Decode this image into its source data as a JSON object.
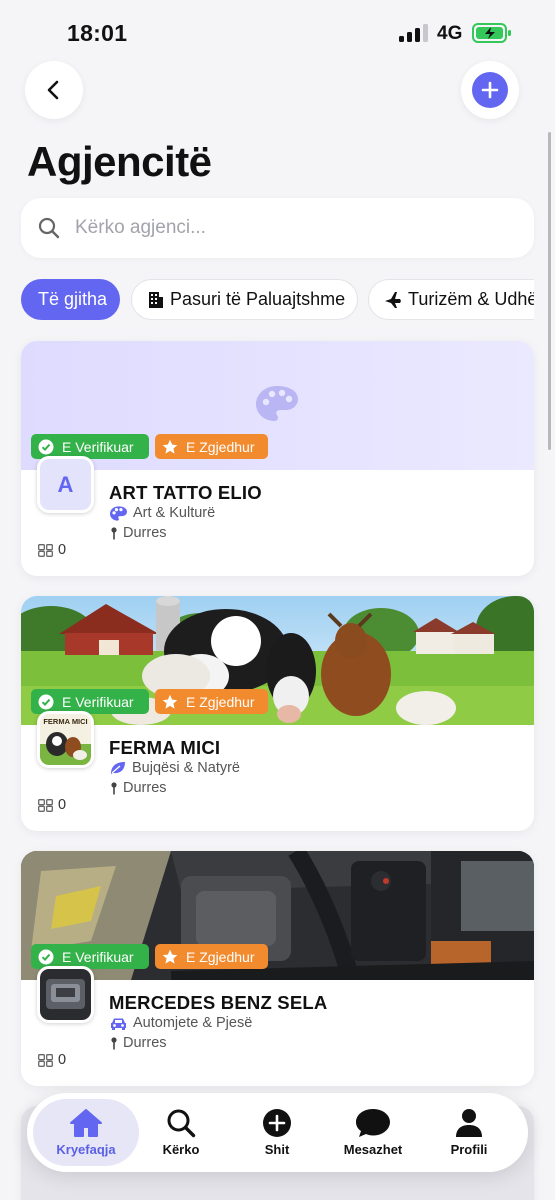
{
  "status_bar": {
    "time": "18:01",
    "network": "4G"
  },
  "header": {
    "title": "Agjencitë"
  },
  "search": {
    "placeholder": "Kërko agjenci..."
  },
  "filters": [
    {
      "label": "Të gjitha",
      "active": true
    },
    {
      "label": "Pasuri të Paluajtshme",
      "icon": "building-icon"
    },
    {
      "label": "Turizëm & Udhë",
      "icon": "airplane-icon"
    }
  ],
  "badges": {
    "verified": "E Verifikuar",
    "featured": "E Zgjedhur"
  },
  "agencies": [
    {
      "name": "ART TATTO ELIO",
      "avatar_letter": "A",
      "category": "Art & Kulturë",
      "category_icon": "palette-icon",
      "location": "Durres",
      "count": "0"
    },
    {
      "name": "FERMA MICI",
      "avatar_text": "FERMA MICI",
      "category": "Bujqësi & Natyrë",
      "category_icon": "leaf-icon",
      "location": "Durres",
      "count": "0"
    },
    {
      "name": "MERCEDES BENZ SELA",
      "category": "Automjete & Pjesë",
      "category_icon": "car-icon",
      "location": "Durres",
      "count": "0"
    }
  ],
  "nav": [
    {
      "label": "Kryefaqja",
      "icon": "home-icon",
      "active": true
    },
    {
      "label": "Kërko",
      "icon": "search-icon"
    },
    {
      "label": "Shit",
      "icon": "plus-circle-icon"
    },
    {
      "label": "Mesazhet",
      "icon": "chat-icon"
    },
    {
      "label": "Profili",
      "icon": "person-icon"
    }
  ],
  "colors": {
    "accent": "#6366f1",
    "verified": "#34b24a",
    "featured": "#f28a2e"
  }
}
